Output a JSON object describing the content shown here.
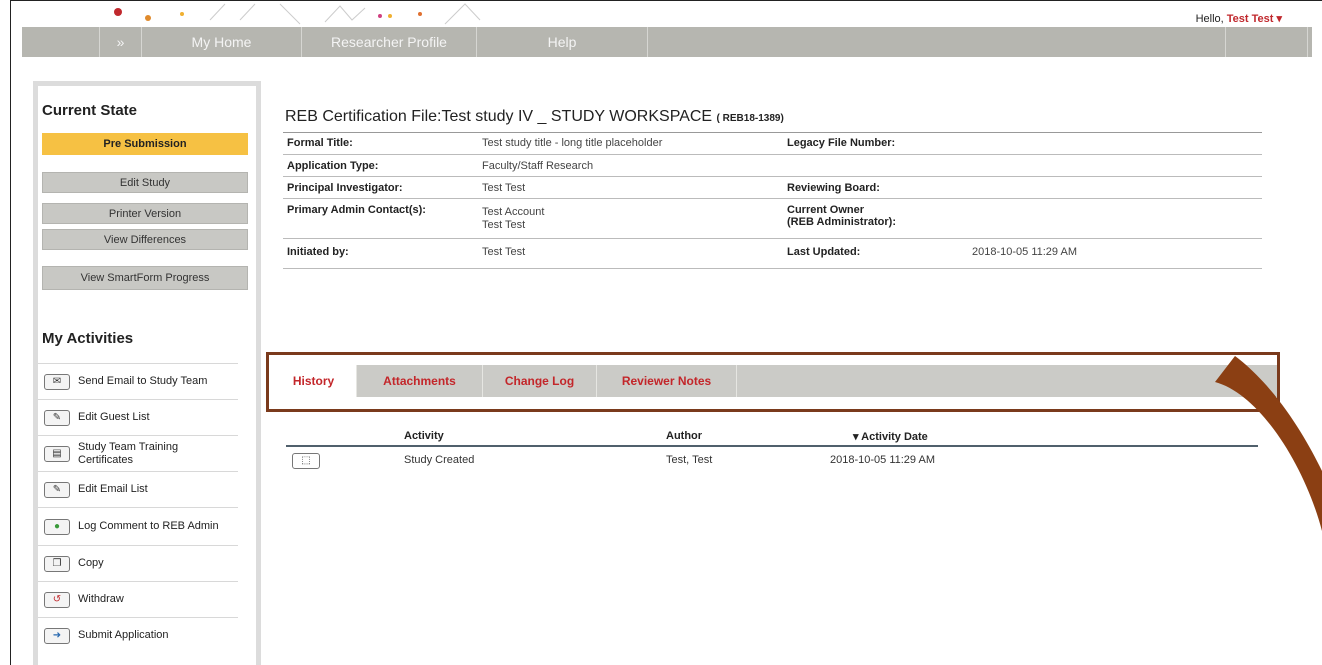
{
  "header": {
    "greeting": "Hello,",
    "user_name": "Test Test ▾"
  },
  "nav": {
    "expand_icon": "»",
    "items": [
      {
        "label": "My Home"
      },
      {
        "label": "Researcher Profile"
      },
      {
        "label": "Help"
      }
    ]
  },
  "sidebar": {
    "current_state_title": "Current State",
    "state_value": "Pre Submission",
    "buttons": [
      {
        "label": "Edit Study"
      },
      {
        "label": "Printer Version"
      },
      {
        "label": "View Differences"
      },
      {
        "label": "View SmartForm Progress"
      }
    ],
    "activities_title": "My Activities",
    "activities": [
      {
        "label": "Send Email to Study Team",
        "icon": "email-icon"
      },
      {
        "label": "Edit Guest List",
        "icon": "edit-icon"
      },
      {
        "label": "Study Team Training Certificates",
        "icon": "certificate-icon"
      },
      {
        "label": "Edit Email List",
        "icon": "edit-icon"
      },
      {
        "label": "Log Comment to REB Admin",
        "icon": "comment-icon"
      },
      {
        "label": "Copy",
        "icon": "copy-icon"
      },
      {
        "label": "Withdraw",
        "icon": "withdraw-icon"
      },
      {
        "label": "Submit Application",
        "icon": "submit-icon"
      }
    ]
  },
  "main": {
    "title": "REB Certification File:Test study IV _ STUDY WORKSPACE",
    "file_id": "( REB18-1389)",
    "fields": {
      "formal_title_label": "Formal Title:",
      "formal_title_value": "Test study title - long title placeholder",
      "legacy_label": "Legacy File Number:",
      "app_type_label": "Application Type:",
      "app_type_value": "Faculty/Staff Research",
      "pi_label": "Principal Investigator:",
      "pi_value": "Test Test",
      "reviewing_label": "Reviewing Board:",
      "admin_contact_label": "Primary Admin Contact(s):",
      "admin_contact_value_1": "Test Account",
      "admin_contact_value_2": "Test Test",
      "owner_label_1": "Current Owner",
      "owner_label_2": "(REB Administrator):",
      "initiated_label": "Initiated by:",
      "initiated_value": "Test Test",
      "updated_label": "Last Updated:",
      "updated_value": "2018-10-05 11:29 AM"
    }
  },
  "tabs": [
    {
      "label": "History"
    },
    {
      "label": "Attachments"
    },
    {
      "label": "Change Log"
    },
    {
      "label": "Reviewer Notes"
    }
  ],
  "history": {
    "columns": [
      "Activity",
      "Author",
      "▾ Activity Date"
    ],
    "rows": [
      {
        "activity": "Study Created",
        "author": "Test, Test",
        "date": "2018-10-05 11:29 AM"
      }
    ]
  },
  "colors": {
    "accent_red": "#c3262a",
    "state_yellow": "#f6c143",
    "nav_gray": "#b6b6b0",
    "highlight_brown": "#7a3a1c"
  }
}
